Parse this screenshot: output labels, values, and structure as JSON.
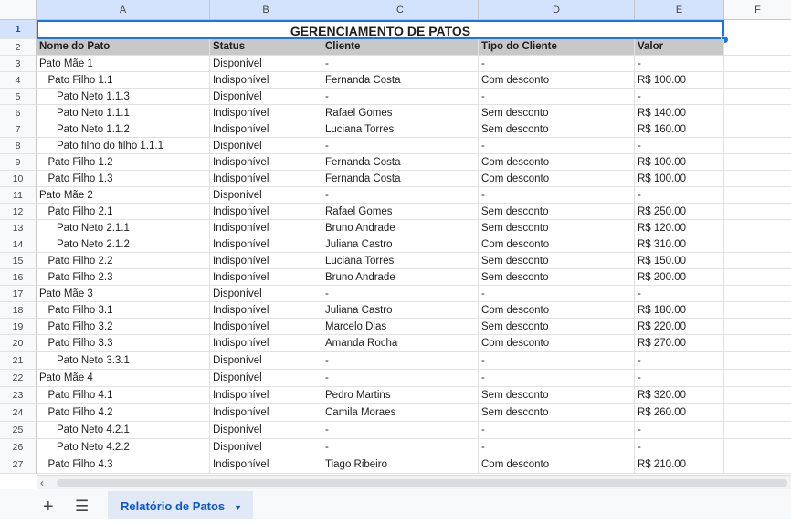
{
  "columns": [
    "A",
    "B",
    "C",
    "D",
    "E",
    "F"
  ],
  "selected_row": "1",
  "title": "GERENCIAMENTO DE PATOS",
  "headers": [
    "Nome do Pato",
    "Status",
    "Cliente",
    "Tipo do Cliente",
    "Valor"
  ],
  "rows": [
    {
      "n": "3",
      "name": "Pato Mãe 1",
      "indent": 0,
      "status": "Disponível",
      "client": "-",
      "type": "-",
      "value": "-"
    },
    {
      "n": "4",
      "name": "Pato Filho 1.1",
      "indent": 1,
      "status": "Indisponível",
      "client": "Fernanda Costa",
      "type": "Com desconto",
      "value": "R$ 100.00"
    },
    {
      "n": "5",
      "name": "Pato Neto 1.1.3",
      "indent": 2,
      "status": "Disponível",
      "client": "-",
      "type": "-",
      "value": "-"
    },
    {
      "n": "6",
      "name": "Pato Neto 1.1.1",
      "indent": 2,
      "status": "Indisponível",
      "client": "Rafael Gomes",
      "type": "Sem desconto",
      "value": "R$ 140.00"
    },
    {
      "n": "7",
      "name": "Pato Neto 1.1.2",
      "indent": 2,
      "status": "Indisponível",
      "client": "Luciana Torres",
      "type": "Sem desconto",
      "value": "R$ 160.00"
    },
    {
      "n": "8",
      "name": "Pato filho do filho 1.1.1",
      "indent": 2,
      "status": "Disponível",
      "client": "-",
      "type": "-",
      "value": "-"
    },
    {
      "n": "9",
      "name": "Pato Filho 1.2",
      "indent": 1,
      "status": "Indisponível",
      "client": "Fernanda Costa",
      "type": "Com desconto",
      "value": "R$ 100.00"
    },
    {
      "n": "10",
      "name": "Pato Filho 1.3",
      "indent": 1,
      "status": "Indisponível",
      "client": "Fernanda Costa",
      "type": "Com desconto",
      "value": "R$ 100.00"
    },
    {
      "n": "11",
      "name": "Pato Mãe 2",
      "indent": 0,
      "status": "Disponível",
      "client": "-",
      "type": "-",
      "value": "-"
    },
    {
      "n": "12",
      "name": "Pato Filho 2.1",
      "indent": 1,
      "status": "Indisponível",
      "client": "Rafael Gomes",
      "type": "Sem desconto",
      "value": "R$ 250.00"
    },
    {
      "n": "13",
      "name": "Pato Neto 2.1.1",
      "indent": 2,
      "status": "Indisponível",
      "client": "Bruno Andrade",
      "type": "Sem desconto",
      "value": "R$ 120.00"
    },
    {
      "n": "14",
      "name": "Pato Neto 2.1.2",
      "indent": 2,
      "status": "Indisponível",
      "client": "Juliana Castro",
      "type": "Com desconto",
      "value": "R$ 310.00"
    },
    {
      "n": "15",
      "name": "Pato Filho 2.2",
      "indent": 1,
      "status": "Indisponível",
      "client": "Luciana Torres",
      "type": "Sem desconto",
      "value": "R$ 150.00"
    },
    {
      "n": "16",
      "name": "Pato Filho 2.3",
      "indent": 1,
      "status": "Indisponível",
      "client": "Bruno Andrade",
      "type": "Sem desconto",
      "value": "R$ 200.00"
    },
    {
      "n": "17",
      "name": "Pato Mãe 3",
      "indent": 0,
      "status": "Disponível",
      "client": "-",
      "type": "-",
      "value": "-"
    },
    {
      "n": "18",
      "name": "Pato Filho 3.1",
      "indent": 1,
      "status": "Indisponível",
      "client": "Juliana Castro",
      "type": "Com desconto",
      "value": "R$ 180.00"
    },
    {
      "n": "19",
      "name": "Pato Filho 3.2",
      "indent": 1,
      "status": "Indisponível",
      "client": "Marcelo Dias",
      "type": "Sem desconto",
      "value": "R$ 220.00"
    },
    {
      "n": "20",
      "name": "Pato Filho 3.3",
      "indent": 1,
      "status": "Indisponível",
      "client": "Amanda Rocha",
      "type": "Com desconto",
      "value": "R$ 270.00"
    },
    {
      "n": "21",
      "name": "Pato Neto 3.3.1",
      "indent": 2,
      "status": "Disponível",
      "client": "-",
      "type": "-",
      "value": "-"
    },
    {
      "n": "22",
      "name": "Pato Mãe 4",
      "indent": 0,
      "status": "Disponível",
      "client": "-",
      "type": "-",
      "value": "-"
    },
    {
      "n": "23",
      "name": "Pato Filho 4.1",
      "indent": 1,
      "status": "Indisponível",
      "client": "Pedro Martins",
      "type": "Sem desconto",
      "value": "R$ 320.00"
    },
    {
      "n": "24",
      "name": "Pato Filho 4.2",
      "indent": 1,
      "status": "Indisponível",
      "client": "Camila Moraes",
      "type": "Sem desconto",
      "value": "R$ 260.00"
    },
    {
      "n": "25",
      "name": "Pato Neto 4.2.1",
      "indent": 2,
      "status": "Disponível",
      "client": "-",
      "type": "-",
      "value": "-"
    },
    {
      "n": "26",
      "name": "Pato Neto 4.2.2",
      "indent": 2,
      "status": "Disponível",
      "client": "-",
      "type": "-",
      "value": "-"
    },
    {
      "n": "27",
      "name": "Pato Filho 4.3",
      "indent": 1,
      "status": "Indisponível",
      "client": "Tiago Ribeiro",
      "type": "Com desconto",
      "value": "R$ 210.00"
    }
  ],
  "tabbar": {
    "add_sheet_icon": "plus-icon",
    "all_sheets_icon": "menu-icon",
    "active_sheet": "Relatório de Patos"
  },
  "scroll_left_icon": "chevron-left-icon"
}
